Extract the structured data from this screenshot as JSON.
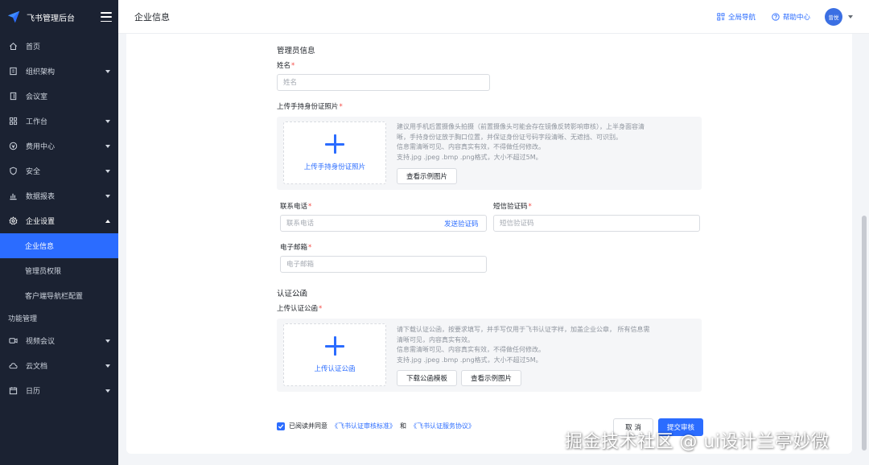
{
  "app": {
    "title": "飞书管理后台"
  },
  "sidebar": {
    "items": [
      {
        "label": "首页",
        "icon": "home-icon"
      },
      {
        "label": "组织架构",
        "icon": "org-icon"
      },
      {
        "label": "会议室",
        "icon": "door-icon"
      },
      {
        "label": "工作台",
        "icon": "grid-icon"
      },
      {
        "label": "费用中心",
        "icon": "coin-icon"
      },
      {
        "label": "安全",
        "icon": "shield-icon"
      },
      {
        "label": "数据报表",
        "icon": "bar-chart-icon"
      },
      {
        "label": "企业设置",
        "icon": "gear-icon"
      }
    ],
    "sub_items": [
      "企业信息",
      "管理员权限",
      "客户端导航栏配置"
    ],
    "group_label": "功能管理",
    "feature_items": [
      {
        "label": "视频会议",
        "icon": "video-icon"
      },
      {
        "label": "云文档",
        "icon": "cloud-icon"
      },
      {
        "label": "日历",
        "icon": "calendar-icon"
      }
    ]
  },
  "header": {
    "page_title": "企业信息",
    "global_nav": "全局导航",
    "help_center": "帮助中心",
    "avatar_text": "曾悦"
  },
  "form": {
    "admin_section": "管理员信息",
    "name_label": "姓名",
    "name_placeholder": "姓名",
    "id_photo_label": "上传手持身份证照片",
    "id_upload_label": "上传手持身份证照片",
    "id_desc": [
      "建议用手机后置摄像头拍摄（前置摄像头可能会存在镜像反转影响审核），上半身面容清",
      "晰，手持身份证放于胸口位置，并保证身份证号码字段清晰、无遮挡、可识别。",
      "信息需清晰可见、内容真实有效，不得做任何修改。",
      "支持.jpg .jpeg .bmp .png格式，大小不超过5M。"
    ],
    "view_sample": "查看示例图片",
    "phone_label": "联系电话",
    "phone_placeholder": "联系电话",
    "send_code": "发送验证码",
    "sms_label": "短信验证码",
    "sms_placeholder": "短信验证码",
    "email_label": "电子邮箱",
    "email_placeholder": "电子邮箱",
    "cert_section": "认证公函",
    "cert_label": "上传认证公函",
    "cert_upload_label": "上传认证公函",
    "cert_desc": [
      "请下载认证公函，按要求填写，并手写仅用于飞书认证字样，加盖企业公章， 所有信息需",
      "清晰可见，内容真实有效。",
      "信息需清晰可见、内容真实有效，不得做任何修改。",
      "支持.jpg .jpeg .bmp .png格式，大小不超过5M。"
    ],
    "download_template": "下载公函模板",
    "view_sample2": "查看示例图片"
  },
  "footer": {
    "agree_prefix": "已阅读并同意",
    "agree_link1": "《飞书认证审核标准》",
    "agree_and": "和",
    "agree_link2": "《飞书认证服务协议》",
    "cancel": "取 消",
    "submit": "提交审核"
  },
  "watermark": "掘金技术社区 @ ui设计兰亭妙微",
  "colors": {
    "accent": "#2b6cff",
    "sidebar_bg": "#1b2232",
    "required": "#f54a45"
  }
}
